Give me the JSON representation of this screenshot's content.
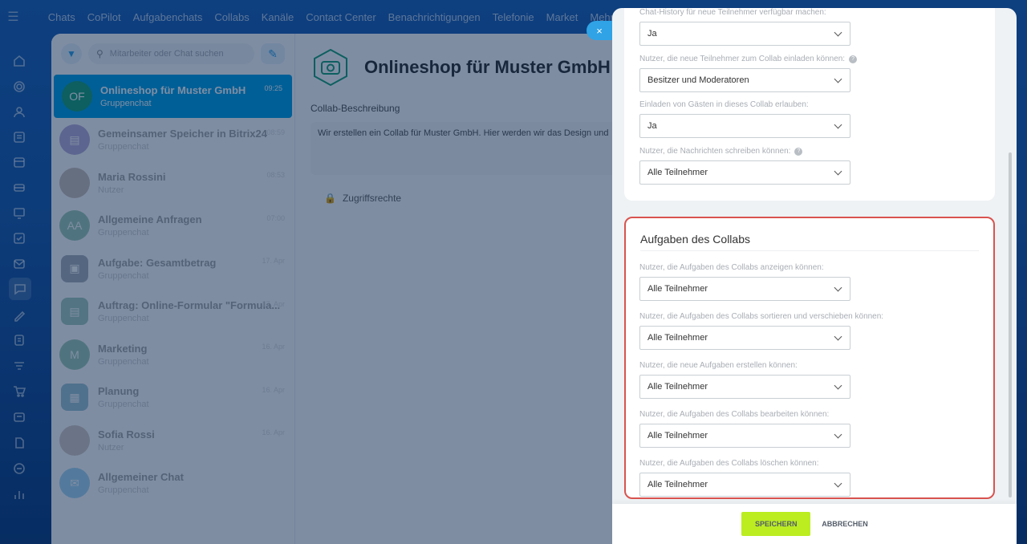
{
  "topnav": {
    "items": [
      "Chats",
      "CoPilot",
      "Aufgabenchats",
      "Collabs",
      "Kanäle",
      "Contact Center",
      "Benachrichtigungen",
      "Telefonie",
      "Market",
      "Mehr"
    ]
  },
  "leftbar": {
    "icons": [
      "home-icon",
      "settings-icon",
      "users-icon",
      "feed-icon",
      "calendar-icon",
      "drive-icon",
      "board-icon",
      "tasks-icon",
      "mail-icon",
      "chat-icon",
      "sign-icon",
      "docs-icon",
      "crm-icon",
      "cart-icon",
      "sites-icon",
      "file-icon",
      "automation-icon",
      "bar-chart-icon"
    ]
  },
  "chatlist": {
    "search_placeholder": "Mitarbeiter oder Chat suchen",
    "chats": [
      {
        "name": "Onlineshop für Muster GmbH",
        "sub": "Gruppenchat",
        "time": "09:25",
        "initials": "OF",
        "color": "#1aa37a"
      },
      {
        "name": "Gemeinsamer Speicher in Bitrix24",
        "sub": "Gruppenchat",
        "time": "08:59",
        "initials": "",
        "color": "#5a3fa8"
      },
      {
        "name": "Maria Rossini",
        "sub": "Nutzer",
        "time": "08:53",
        "initials": "",
        "color": "#8a7060"
      },
      {
        "name": "Allgemeine Anfragen",
        "sub": "Gruppenchat",
        "time": "07:00",
        "initials": "AA",
        "color": "#1e8a5a"
      },
      {
        "name": "Aufgabe: Gesamtbetrag",
        "sub": "Gruppenchat",
        "time": "17. Apr",
        "initials": "",
        "color": "#3a4a60"
      },
      {
        "name": "Auftrag: Online-Formular \"Formula...",
        "sub": "Gruppenchat",
        "time": "17. Apr",
        "initials": "",
        "color": "#2a8a6a"
      },
      {
        "name": "Marketing",
        "sub": "Gruppenchat",
        "time": "16. Apr",
        "initials": "M",
        "color": "#1e8a5a"
      },
      {
        "name": "Planung",
        "sub": "Gruppenchat",
        "time": "16. Apr",
        "initials": "",
        "color": "#1a7a9a"
      },
      {
        "name": "Sofia Rossi",
        "sub": "Nutzer",
        "time": "16. Apr",
        "initials": "",
        "color": "#9a8878"
      },
      {
        "name": "Allgemeiner Chat",
        "sub": "Gruppenchat",
        "time": "",
        "initials": "",
        "color": "#2fa3e6"
      }
    ]
  },
  "detail": {
    "title": "Onlineshop für Muster GmbH",
    "desc_label": "Collab-Beschreibung",
    "desc_text": "Wir erstellen ein Collab für Muster GmbH. Hier werden wir das Design und",
    "access_label": "Zugriffsrechte"
  },
  "slider": {
    "close": "×",
    "chat_settings": [
      {
        "label": "Chat-History für neue Teilnehmer verfügbar machen:",
        "value": "Ja",
        "help": false
      },
      {
        "label": "Nutzer, die neue Teilnehmer zum Collab einladen können:",
        "value": "Besitzer und Moderatoren",
        "help": true
      },
      {
        "label": "Einladen von Gästen in dieses Collab erlauben:",
        "value": "Ja",
        "help": false
      },
      {
        "label": "Nutzer, die Nachrichten schreiben können:",
        "value": "Alle Teilnehmer",
        "help": true
      }
    ],
    "tasks_title": "Aufgaben des Collabs",
    "task_settings": [
      {
        "label": "Nutzer, die Aufgaben des Collabs anzeigen können:",
        "value": "Alle Teilnehmer"
      },
      {
        "label": "Nutzer, die Aufgaben des Collabs sortieren und verschieben können:",
        "value": "Alle Teilnehmer"
      },
      {
        "label": "Nutzer, die neue Aufgaben erstellen können:",
        "value": "Alle Teilnehmer"
      },
      {
        "label": "Nutzer, die Aufgaben des Collabs bearbeiten können:",
        "value": "Alle Teilnehmer"
      },
      {
        "label": "Nutzer, die Aufgaben des Collabs löschen können:",
        "value": "Alle Teilnehmer"
      }
    ],
    "save_label": "SPEICHERN",
    "cancel_label": "ABBRECHEN"
  },
  "colors": {
    "accent": "#2fa3e6",
    "save": "#bbed21",
    "highlight": "#d9534f",
    "selected_chat": "#00a2e8"
  }
}
